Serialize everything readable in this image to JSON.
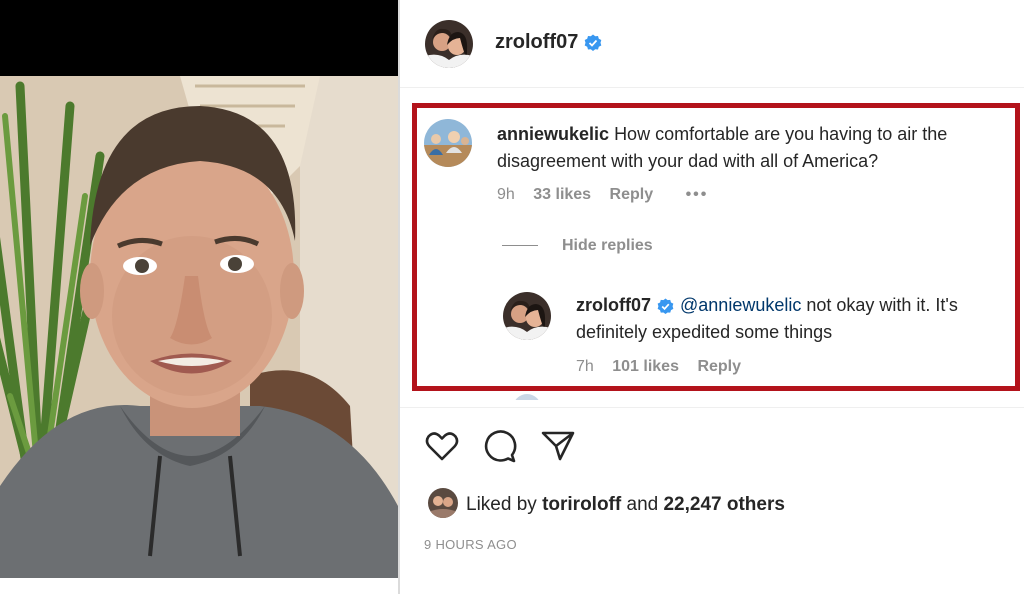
{
  "post": {
    "author": "zroloff07",
    "author_verified": true
  },
  "comments": [
    {
      "username": "anniewukelic",
      "text": "How comfortable are you having to air the disagreement with your dad with all of America?",
      "age": "9h",
      "likes": "33 likes",
      "reply_label": "Reply",
      "more_label": "•••",
      "hide_replies_label": "Hide replies",
      "replies": [
        {
          "username": "zroloff07",
          "verified": true,
          "mention": "@anniewukelic",
          "text": " not okay with it. It's definitely expedited some things",
          "age": "7h",
          "likes": "101 likes",
          "reply_label": "Reply"
        }
      ]
    }
  ],
  "actions": {
    "icons": [
      "heart-icon",
      "comment-icon",
      "share-icon"
    ]
  },
  "likes": {
    "prefix": "Liked by",
    "user": "toriroloff",
    "conjunction": "and",
    "others": "22,247 others"
  },
  "timestamp": "9 HOURS AGO",
  "colors": {
    "highlight_border": "#b3131b",
    "verified_blue": "#3897f0",
    "mention_blue": "#00376b",
    "meta_gray": "#8e8e8e",
    "text": "#262626"
  }
}
